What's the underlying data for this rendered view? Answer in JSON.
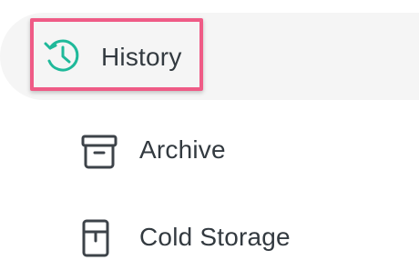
{
  "nav": {
    "items": [
      {
        "label": "History",
        "icon": "history-icon",
        "active": true
      },
      {
        "label": "Archive",
        "icon": "archive-icon",
        "active": false
      },
      {
        "label": "Cold Storage",
        "icon": "cold-storage-icon",
        "active": false
      }
    ]
  },
  "colors": {
    "accent": "#1fb99a",
    "highlight": "#ef5b86",
    "active_bg": "#f5f5f5",
    "text": "#333a40",
    "icon": "#3d4349"
  }
}
